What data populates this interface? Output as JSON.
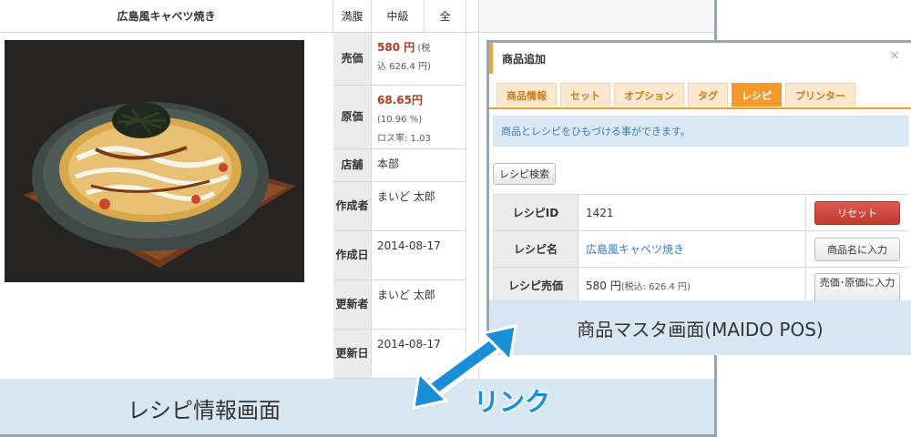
{
  "left": {
    "title": "広島風キャベツ焼き",
    "stats": [
      "満腹",
      "中級",
      "全"
    ],
    "caption": "レシピ情報画面",
    "rows": [
      {
        "label": "売価",
        "line1": "580 円",
        "line1_suffix": " (税",
        "line2": "込 626.4 円)"
      },
      {
        "label": "原価",
        "line1": "68.65円",
        "line2": "(10.96 %)",
        "line3": "ロス率: 1.03"
      },
      {
        "label": "店舗",
        "value": "本部"
      },
      {
        "label": "作成者",
        "value": "まいど 太郎"
      },
      {
        "label": "作成日",
        "value": "2014-08-17"
      },
      {
        "label": "更新者",
        "value": "まいど 太郎"
      },
      {
        "label": "更新日",
        "value": "2014-08-17"
      }
    ]
  },
  "dialog": {
    "title": "商品追加",
    "close": "×",
    "tabs": [
      "商品情報",
      "セット",
      "オプション",
      "タグ",
      "レシピ",
      "プリンター"
    ],
    "active_tab": "レシピ",
    "banner": "商品とレシピをひもづける事ができます。",
    "search_button": "レシピ検索",
    "rows": [
      {
        "label": "レシピID",
        "value": "1421",
        "button": "リセット"
      },
      {
        "label": "レシピ名",
        "value": "広島風キャベツ焼き",
        "button": "商品名に入力"
      },
      {
        "label": "レシピ売価",
        "value": "580 円",
        "value_note": " (税込: 626.4 円)",
        "button": "売価･原価に入力"
      }
    ],
    "caption": "商品マスタ画面(MAIDO POS)"
  },
  "link_label": "リンク",
  "colors": {
    "accent_orange": "#f49a2a",
    "link_blue": "#1a8fd8",
    "reset_red": "#c03a33",
    "band_blue": "#d8e6f2"
  }
}
